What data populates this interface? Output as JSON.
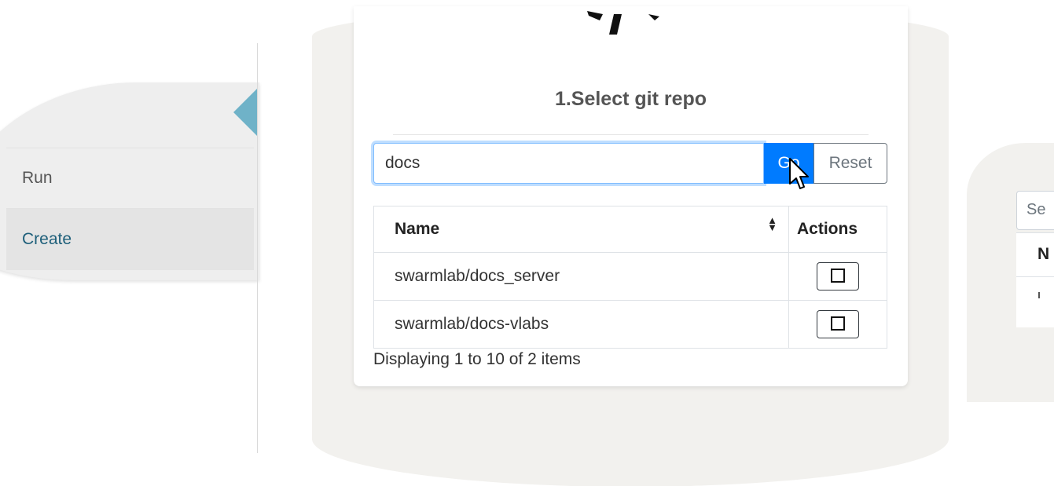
{
  "sidebar": {
    "items": [
      {
        "label": "Run"
      },
      {
        "label": "Create"
      }
    ]
  },
  "card": {
    "title": "1.Select git repo",
    "search": {
      "value": "docs",
      "placeholder": ""
    },
    "go_label": "Go",
    "reset_label": "Reset",
    "table": {
      "columns": [
        "Name",
        "Actions"
      ],
      "rows": [
        {
          "name": "swarmlab/docs_server"
        },
        {
          "name": "swarmlab/docs-vlabs"
        }
      ]
    },
    "footer": "Displaying 1 to 10 of 2 items"
  },
  "right_panel": {
    "search_placeholder": "Se",
    "column_header": "N"
  },
  "colors": {
    "accent": "#007bff",
    "active_link": "#1e5f7a",
    "sidebar_arrow": "#6fb2c8"
  }
}
